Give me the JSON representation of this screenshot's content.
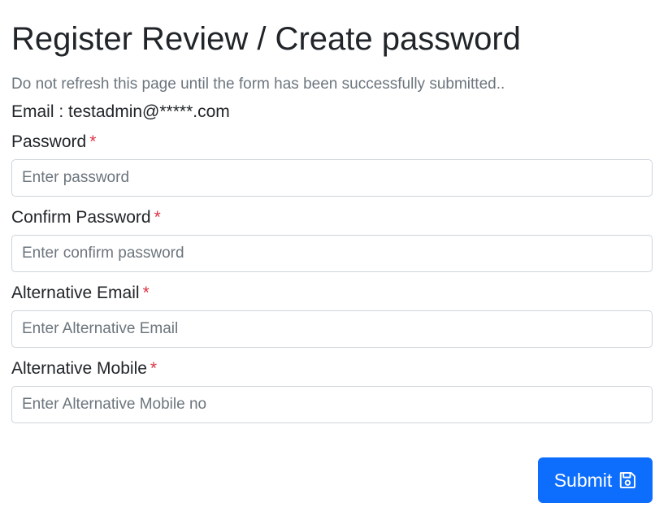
{
  "page": {
    "title": "Register Review / Create password",
    "notice": "Do not refresh this page until the form has been successfully submitted..",
    "email_line": "Email : testadmin@*****.com"
  },
  "form": {
    "required_marker": "*",
    "fields": [
      {
        "label": "Password",
        "placeholder": "Enter password",
        "value": ""
      },
      {
        "label": "Confirm Password",
        "placeholder": "Enter confirm password",
        "value": ""
      },
      {
        "label": "Alternative Email",
        "placeholder": "Enter Alternative Email",
        "value": ""
      },
      {
        "label": "Alternative Mobile",
        "placeholder": "Enter Alternative Mobile no",
        "value": ""
      }
    ],
    "submit_label": "Submit",
    "submit_icon": "floppy-disk-icon"
  },
  "colors": {
    "primary": "#0d6efd",
    "required": "#dc3545",
    "muted": "#6c757d",
    "text": "#212529",
    "input_border": "#ced4da"
  }
}
